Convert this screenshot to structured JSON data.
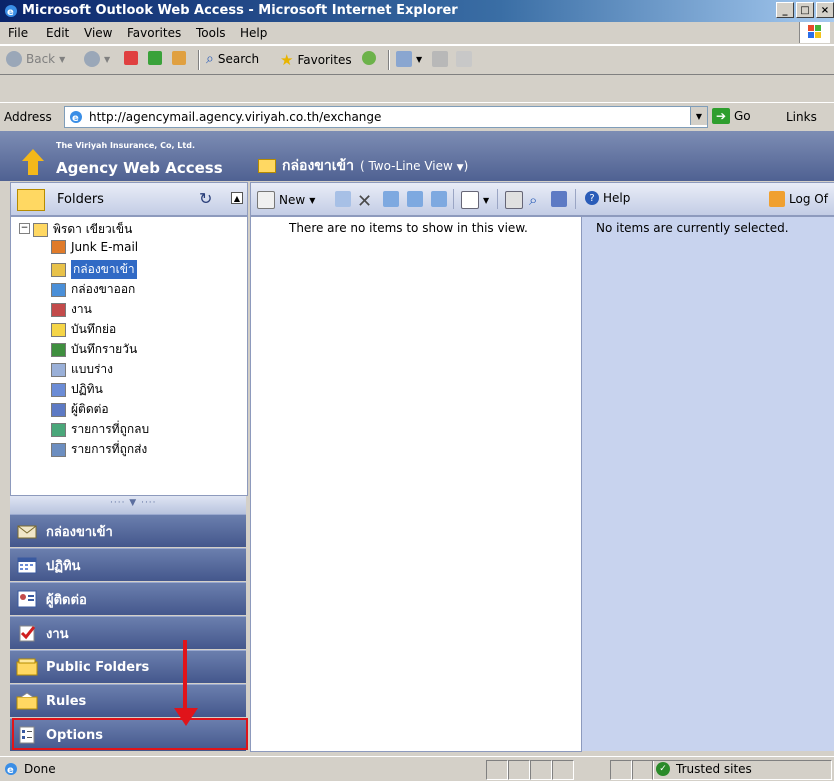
{
  "window": {
    "title": "Microsoft Outlook Web Access - Microsoft Internet Explorer",
    "controls": {
      "minimize": "_",
      "maximize": "□",
      "close": "×"
    }
  },
  "menu": {
    "items": [
      {
        "label": "File"
      },
      {
        "label": "Edit"
      },
      {
        "label": "View"
      },
      {
        "label": "Favorites"
      },
      {
        "label": "Tools"
      },
      {
        "label": "Help"
      }
    ]
  },
  "toolbar": {
    "back": "Back",
    "search": "Search",
    "favorites": "Favorites"
  },
  "address": {
    "label": "Address",
    "url": "http://agencymail.agency.viriyah.co.th/exchange",
    "go": "Go",
    "links": "Links"
  },
  "owa": {
    "brand_small": "The Viriyah Insurance, Co, Ltd.",
    "brand_big": "Agency Web Access",
    "folder_title": "กล่องขาเข้า",
    "view_mode": "( Two-Line View",
    "view_close": ")"
  },
  "folders_panel": {
    "header": "Folders",
    "root": "พิรดา เขียวเข็น",
    "items": [
      {
        "label": "Junk E-mail",
        "icon": "junk-icon",
        "color": "#e07b2a"
      },
      {
        "label": "กล่องขาเข้า",
        "icon": "inbox-icon",
        "color": "#e8c24a",
        "selected": true
      },
      {
        "label": "กล่องขาออก",
        "icon": "outbox-icon",
        "color": "#4a8fd8"
      },
      {
        "label": "งาน",
        "icon": "tasks-icon",
        "color": "#c34b4b"
      },
      {
        "label": "บันทึกย่อ",
        "icon": "notes-icon",
        "color": "#f5d547"
      },
      {
        "label": "บันทึกรายวัน",
        "icon": "journal-icon",
        "color": "#3f8f3f"
      },
      {
        "label": "แบบร่าง",
        "icon": "drafts-icon",
        "color": "#9ab0d8"
      },
      {
        "label": "ปฏิทิน",
        "icon": "calendar-icon",
        "color": "#6b8cd6"
      },
      {
        "label": "ผู้ติดต่อ",
        "icon": "contacts-icon",
        "color": "#5d7ac4"
      },
      {
        "label": "รายการที่ถูกลบ",
        "icon": "deleted-items-icon",
        "color": "#4aa77a"
      },
      {
        "label": "รายการที่ถูกส่ง",
        "icon": "sent-items-icon",
        "color": "#6c8ec0"
      }
    ]
  },
  "nav": {
    "items": [
      {
        "label": "กล่องขาเข้า",
        "icon": "inbox-icon"
      },
      {
        "label": "ปฏิทิน",
        "icon": "calendar-icon"
      },
      {
        "label": "ผู้ติดต่อ",
        "icon": "contacts-icon"
      },
      {
        "label": "งาน",
        "icon": "tasks-icon"
      },
      {
        "label": "Public Folders",
        "icon": "public-folders-icon"
      },
      {
        "label": "Rules",
        "icon": "rules-icon"
      },
      {
        "label": "Options",
        "icon": "options-icon"
      }
    ]
  },
  "main_toolbar": {
    "new": "New",
    "help": "Help",
    "logoff": "Log Of"
  },
  "list": {
    "empty": "There are no items to show in this view."
  },
  "reading": {
    "empty": "No items are currently selected."
  },
  "status": {
    "text": "Done",
    "zone": "Trusted sites"
  },
  "colors": {
    "highlight": "#e0141a",
    "nav_bg": "#4f6192",
    "reading_bg": "#c8d3ee"
  }
}
